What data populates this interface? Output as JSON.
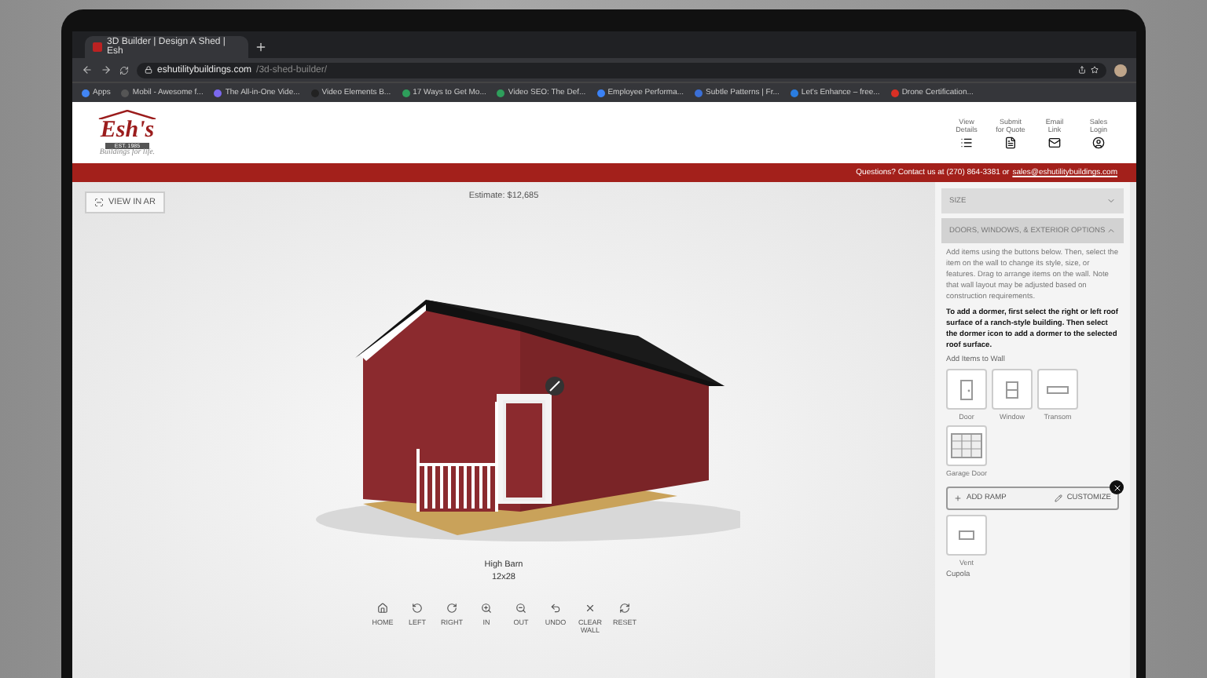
{
  "browser": {
    "tab_title": "3D Builder | Design A Shed | Esh",
    "url_host": "eshutilitybuildings.com",
    "url_path": "/3d-shed-builder/",
    "bookmarks": [
      {
        "label": "Apps",
        "color": "#4285f4"
      },
      {
        "label": "Mobil - Awesome f...",
        "color": "#555555"
      },
      {
        "label": "The All-in-One Vide...",
        "color": "#7b68ee"
      },
      {
        "label": "Video Elements B...",
        "color": "#222222"
      },
      {
        "label": "17 Ways to Get Mo...",
        "color": "#2e9e5b"
      },
      {
        "label": "Video SEO: The Def...",
        "color": "#2e9e5b"
      },
      {
        "label": "Employee Performa...",
        "color": "#3b82f6"
      },
      {
        "label": "Subtle Patterns | Fr...",
        "color": "#3b6fd6"
      },
      {
        "label": "Let's Enhance – free...",
        "color": "#2a7de1"
      },
      {
        "label": "Drone Certification...",
        "color": "#d93025"
      }
    ]
  },
  "header": {
    "logo": "Esh's",
    "logo_badge": "EST. 1985",
    "tagline": "Buildings for life.",
    "nav": [
      {
        "label": "View Details",
        "kind": "list"
      },
      {
        "label": "Submit for Quote",
        "kind": "file"
      },
      {
        "label": "Email Link",
        "kind": "mail"
      },
      {
        "label": "Sales Login",
        "kind": "user"
      }
    ]
  },
  "contact_bar": {
    "text": "Questions? Contact us at (270) 864-3381 or",
    "email": "sales@eshutilitybuildings.com"
  },
  "viewer": {
    "ar_button": "VIEW IN AR",
    "estimate": "Estimate: $12,685",
    "model_name": "High Barn",
    "model_size": "12x28",
    "toolbar": [
      {
        "label": "HOME",
        "kind": "home"
      },
      {
        "label": "LEFT",
        "kind": "left"
      },
      {
        "label": "RIGHT",
        "kind": "right"
      },
      {
        "label": "IN",
        "kind": "in"
      },
      {
        "label": "OUT",
        "kind": "out"
      },
      {
        "label": "UNDO",
        "kind": "undo"
      },
      {
        "label": "CLEAR WALL",
        "kind": "clear"
      },
      {
        "label": "RESET",
        "kind": "reset"
      }
    ]
  },
  "sidebar": {
    "sections": [
      {
        "title": "SIZE",
        "expanded": false
      },
      {
        "title": "DOORS, WINDOWS, & EXTERIOR OPTIONS",
        "expanded": true
      }
    ],
    "intro": "Add items using the buttons below. Then, select the item on the wall to change its style, size, or features. Drag to arrange items on the wall. Note that wall layout may be adjusted based on construction requirements.",
    "dormer_note": "To add a dormer, first select the right or left roof surface of a ranch-style building. Then select the dormer icon to add a dormer to the selected roof surface.",
    "add_heading": "Add Items to Wall",
    "items": [
      {
        "label": "Door",
        "kind": "door"
      },
      {
        "label": "Window",
        "kind": "window"
      },
      {
        "label": "Transom",
        "kind": "transom"
      },
      {
        "label": "Garage Door",
        "kind": "garage"
      }
    ],
    "popup": {
      "add_ramp": "ADD RAMP",
      "customize": "CUSTOMIZE"
    },
    "items_after": [
      {
        "label": "Vent",
        "kind": "vent"
      }
    ],
    "next_heading": "Cupola"
  }
}
